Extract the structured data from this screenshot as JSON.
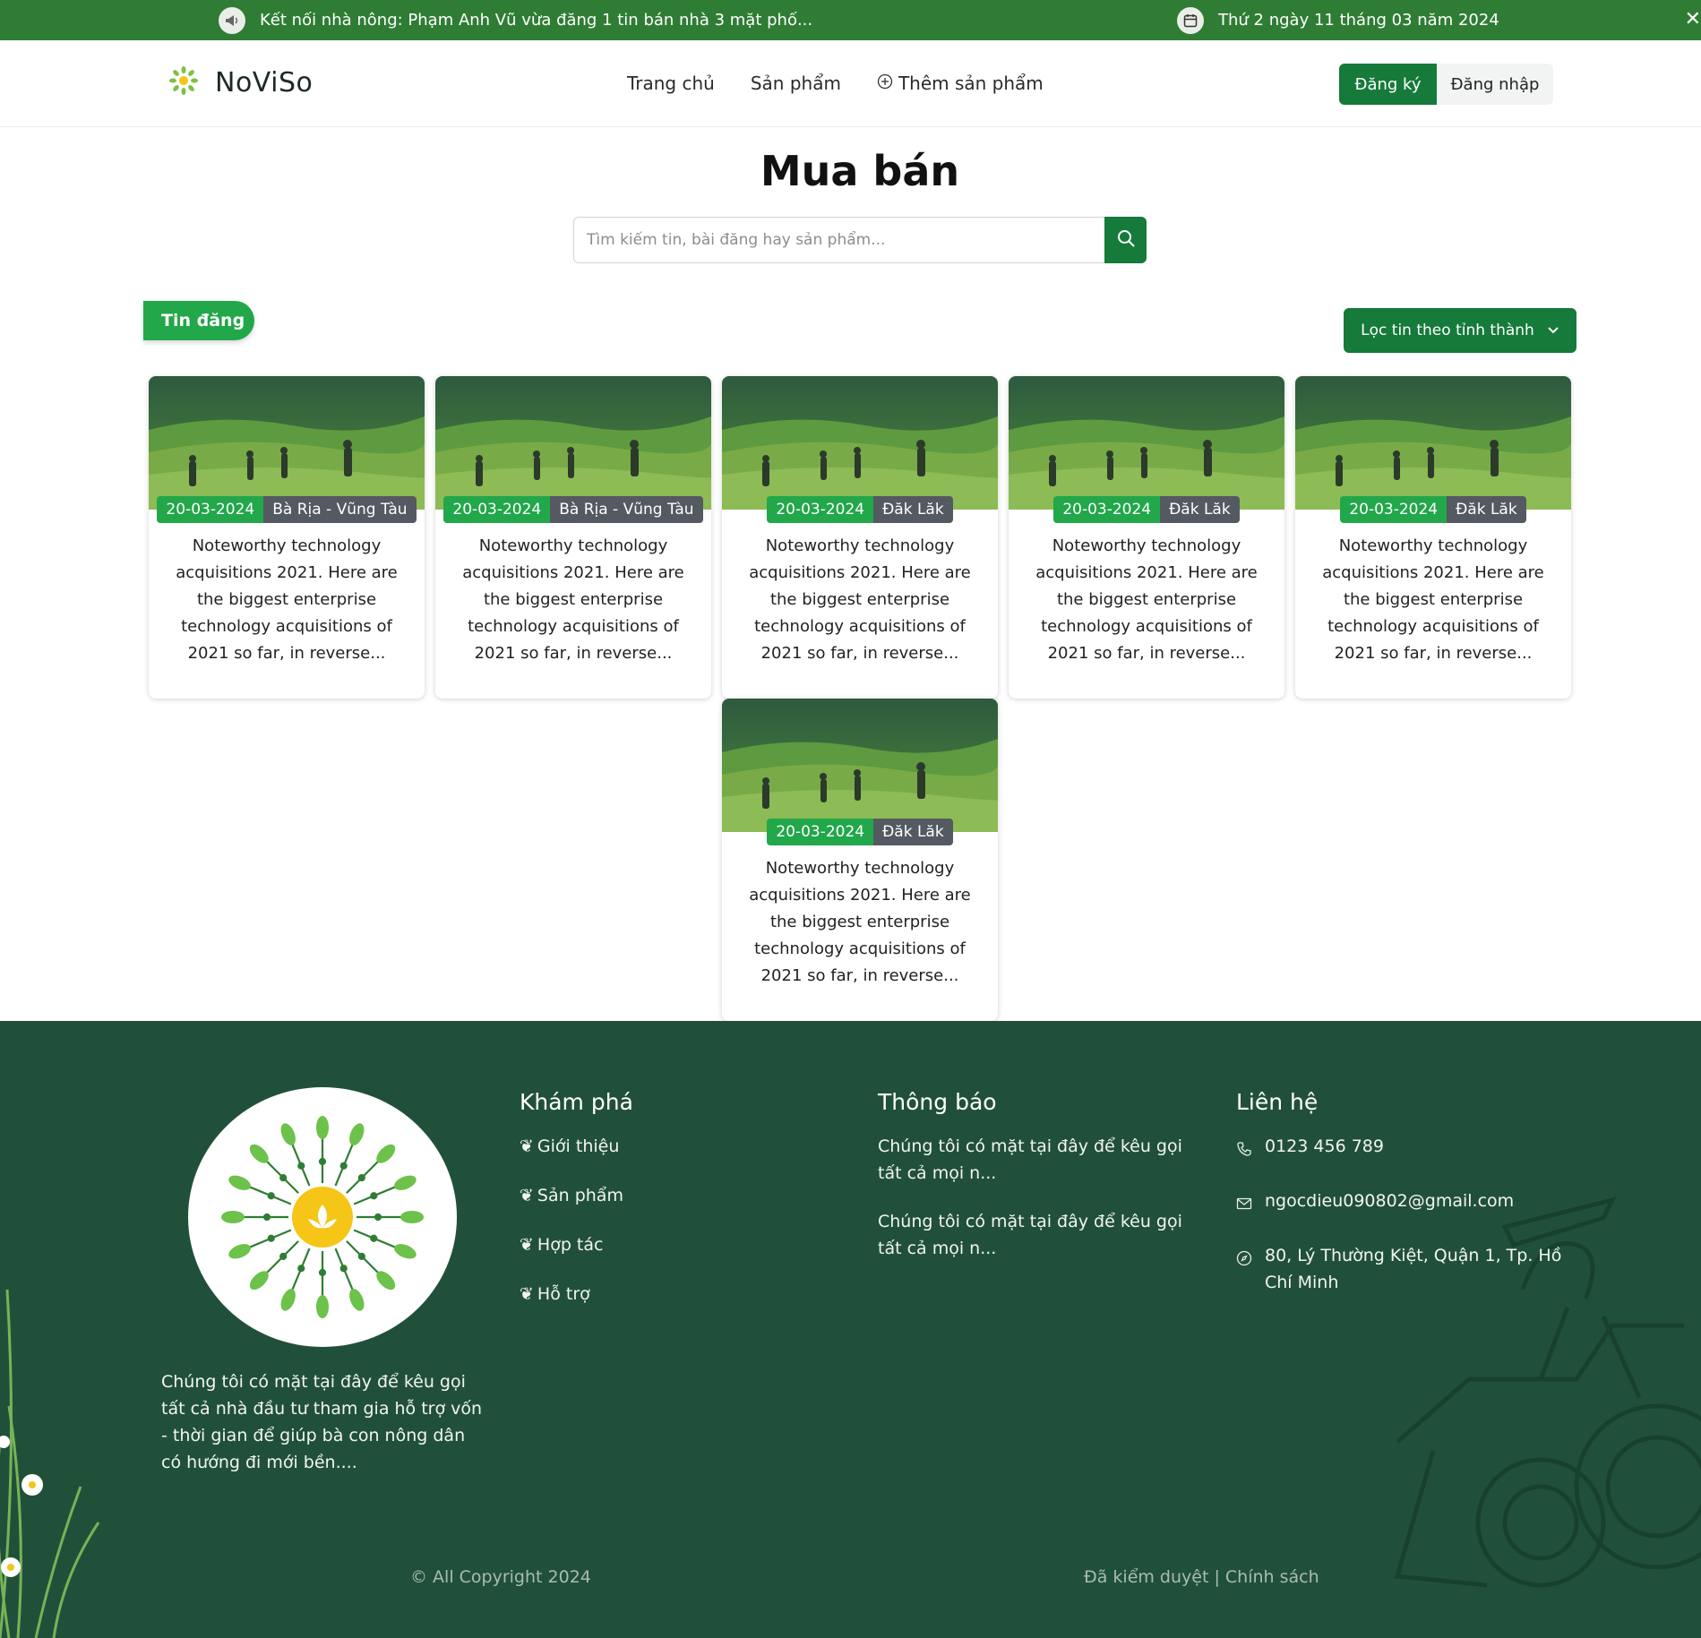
{
  "topbar": {
    "news_icon": "megaphone-icon",
    "news_text": "Kết nối nhà nông: Phạm Anh Vũ vừa đăng 1 tin bán nhà 3 mặt phố...",
    "date_icon": "calendar-icon",
    "date_text": "Thứ 2 ngày 11 tháng 03 năm 2024",
    "close_icon": "close-icon"
  },
  "header": {
    "brand": "NoViSo",
    "nav": [
      {
        "label": "Trang chủ"
      },
      {
        "label": "Sản phẩm"
      },
      {
        "label": "Thêm sản phẩm",
        "icon": "plus-circle-icon"
      }
    ],
    "register": "Đăng ký",
    "login": "Đăng nhập"
  },
  "main": {
    "title": "Mua bán",
    "search_placeholder": "Tìm kiếm tin, bài đăng hay sản phẩm...",
    "section_tag": "Tin đăng",
    "filter_label": "Lọc tin theo tỉnh thành"
  },
  "cards": [
    {
      "date": "20-03-2024",
      "location": "Bà Rịa - Vũng Tàu",
      "text": "Noteworthy technology acquisitions 2021. Here are the biggest enterprise technology acquisitions of 2021 so far, in reverse..."
    },
    {
      "date": "20-03-2024",
      "location": "Bà Rịa - Vũng Tàu",
      "text": "Noteworthy technology acquisitions 2021. Here are the biggest enterprise technology acquisitions of 2021 so far, in reverse..."
    },
    {
      "date": "20-03-2024",
      "location": "Đăk Lăk",
      "text": "Noteworthy technology acquisitions 2021. Here are the biggest enterprise technology acquisitions of 2021 so far, in reverse..."
    },
    {
      "date": "20-03-2024",
      "location": "Đăk Lăk",
      "text": "Noteworthy technology acquisitions 2021. Here are the biggest enterprise technology acquisitions of 2021 so far, in reverse..."
    },
    {
      "date": "20-03-2024",
      "location": "Đăk Lăk",
      "text": "Noteworthy technology acquisitions 2021. Here are the biggest enterprise technology acquisitions of 2021 so far, in reverse..."
    },
    {
      "date": "20-03-2024",
      "location": "Đăk Lăk",
      "text": "Noteworthy technology acquisitions 2021. Here are the biggest enterprise technology acquisitions of 2021 so far, in reverse..."
    }
  ],
  "footer": {
    "about": "Chúng tôi có mặt tại đây để kêu gọi tất cả nhà đầu tư tham gia hỗ trợ vốn - thời gian để giúp bà con nông dân có hướng đi mới bền....",
    "explore": {
      "title": "Khám phá",
      "links": [
        "Giới thiệu",
        "Sản phẩm",
        "Hợp tác",
        "Hỗ trợ"
      ]
    },
    "notices": {
      "title": "Thông báo",
      "items": [
        "Chúng tôi có mặt tại đây để kêu gọi tất cả mọi n...",
        "Chúng tôi có mặt tại đây để kêu gọi tất cả mọi n..."
      ]
    },
    "contact": {
      "title": "Liên hệ",
      "phone": "0123 456 789",
      "email": "ngocdieu090802@gmail.com",
      "address": "80, Lý Thường Kiệt, Quận 1, Tp. Hồ Chí Minh"
    },
    "copyright": "© All Copyright 2024",
    "policy": "Đã kiểm duyệt | Chính sách"
  },
  "colors": {
    "topbar": "#2f7d34",
    "primary": "#157a3a",
    "accent": "#22a74a",
    "footer": "#21503a"
  }
}
